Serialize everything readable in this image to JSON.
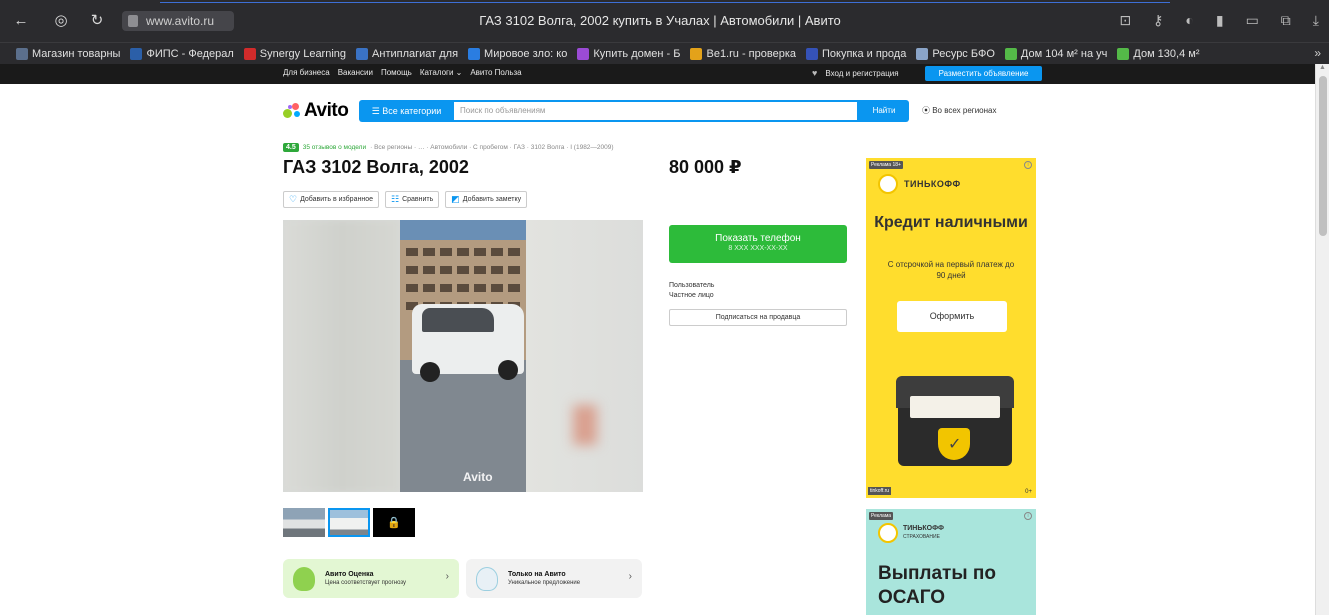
{
  "browser": {
    "url": "www.avito.ru",
    "title": "ГАЗ 3102 Волга, 2002 купить в Учалах | Автомобили | Авито",
    "bookmarks": [
      {
        "label": "Магазин товарны",
        "color": "#5b6f8c"
      },
      {
        "label": "ФИПС - Федерал",
        "color": "#2b5fa8"
      },
      {
        "label": "Synergy Learning",
        "color": "#d12b2b"
      },
      {
        "label": "Антиплагиат для",
        "color": "#3a72c4"
      },
      {
        "label": "Мировое зло: ко",
        "color": "#2a7de1"
      },
      {
        "label": "Купить домен - Б",
        "color": "#9b4bd6"
      },
      {
        "label": "Be1.ru - проверка",
        "color": "#e3a21a"
      },
      {
        "label": "Покупка и прода",
        "color": "#3552b8"
      },
      {
        "label": "Ресурс БФО",
        "color": "#8aa4c8"
      },
      {
        "label": "Дом 104 м² на уч",
        "color": "#54b948"
      },
      {
        "label": "Дом 130,4 м²",
        "color": "#54b948"
      }
    ],
    "more": "»"
  },
  "avito_bar": {
    "links": [
      "Для бизнеса",
      "Вакансии",
      "Помощь",
      "Каталоги ⌄",
      "Авито Польза"
    ],
    "login": "Вход и регистрация",
    "post_ad": "Разместить объявление"
  },
  "header": {
    "logo": "Avito",
    "categories": "☰ Все категории",
    "search_placeholder": "Поиск по объявлениям",
    "find": "Найти",
    "region": "⦿ Во всех регионах"
  },
  "breadcrumb": {
    "rating": "4.5",
    "reviews": "35 отзывов о модели",
    "path": "· Все регионы · … · Автомобили · С пробегом · ГАЗ · 3102 Волга · I (1982—2009)"
  },
  "listing": {
    "title": "ГАЗ 3102 Волга, 2002",
    "price": "80 000 ₽",
    "favorite": "Добавить в избранное",
    "compare": "Сравнить",
    "note": "Добавить заметку",
    "watermark": "Avito",
    "thumb_lock": "🔒"
  },
  "cards": [
    {
      "title": "Авито Оценка",
      "sub": "Цена соответствует прогнозу",
      "chevron": "›"
    },
    {
      "title": "Только на Авито",
      "sub": "Уникальное предложение",
      "chevron": "›"
    }
  ],
  "contact": {
    "show_phone": "Показать телефон",
    "phone_mask": "8 XXX XXX-XX-XX",
    "seller_name": "Пользователь",
    "seller_type": "Частное лицо",
    "subscribe": "Подписаться на продавца"
  },
  "ad1": {
    "label": "Реклама 18+",
    "brand": "ТИНЬКОФФ",
    "headline": "Кредит наличными",
    "sub": "С отсрочкой на первый платеж до 90 дней",
    "button": "Оформить",
    "foot_left": "tinkoff.ru",
    "foot_right": "0+"
  },
  "ad2": {
    "label": "Реклама",
    "brand": "ТИНЬКОФФ",
    "brand_sub": "СТРАХОВАНИЕ",
    "headline": "Выплаты по ОСАГО"
  }
}
